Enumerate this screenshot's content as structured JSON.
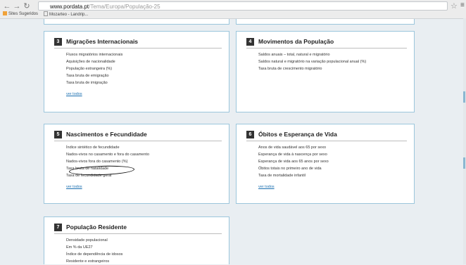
{
  "browser": {
    "url_host": "www.pordata.pt",
    "url_path": "/Tema/Europa/População-25",
    "bookmarks": [
      "Sites Sugeridos",
      "Mozarteo - Landrip..."
    ]
  },
  "cards": [
    {
      "number": "3",
      "title": "Migrações Internacionais",
      "items": [
        "Fluxos migratórios internacionais",
        "Aquisições de nacionalidade",
        "População estrangeira (%)",
        "Taxa bruta de emigração",
        "Taxa bruta de imigração"
      ],
      "link": "ver todos"
    },
    {
      "number": "4",
      "title": "Movimentos da População",
      "items": [
        "Saldos anuais – total, natural e migratório",
        "Saldos natural e migratório na variação populacional anual (%)",
        "Taxa bruta de crescimento migratório"
      ],
      "link": ""
    },
    {
      "number": "5",
      "title": "Nascimentos e Fecundidade",
      "items": [
        "Índice sintético de fecundidade",
        "Nados-vivos no casamento e fora do casamento",
        "Nados-vivos fora do casamento (%)",
        "Taxa bruta de natalidade",
        "Taxa de fecundidade geral"
      ],
      "link": "ver todos"
    },
    {
      "number": "6",
      "title": "Óbitos e Esperança de Vida",
      "items": [
        "Anos de vida saudável aos 65 por sexo",
        "Esperança de vida à nascença por sexo",
        "Esperança de vida aos 65 anos por sexo",
        "Óbitos totais no primeiro ano de vida",
        "Taxa de mortalidade infantil"
      ],
      "link": "ver todos"
    },
    {
      "number": "7",
      "title": "População Residente",
      "items": [
        "Densidade populacional",
        "Em % da UE27",
        "Índice de dependência de idosos",
        "Residente e estrangeiros"
      ],
      "link": ""
    }
  ]
}
